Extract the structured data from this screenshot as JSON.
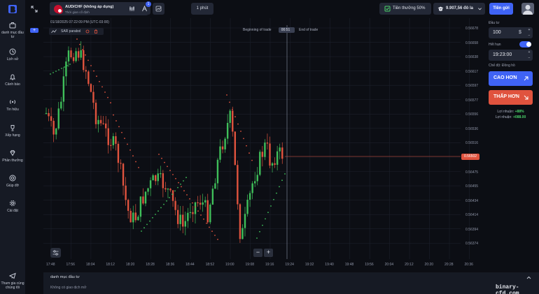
{
  "sidebar": {
    "logo": "brand-logo",
    "badge": "+",
    "items": [
      {
        "label": "danh mục đầu tư",
        "icon": "briefcase-icon"
      },
      {
        "label": "Lịch sử",
        "icon": "history-icon"
      },
      {
        "label": "Cảnh báo",
        "icon": "bell-icon"
      },
      {
        "label": "Tin hiệu",
        "icon": "signal-icon"
      },
      {
        "label": "Xếp hạng",
        "icon": "trophy-icon"
      },
      {
        "label": "Phần thưởng",
        "icon": "diamond-icon"
      },
      {
        "label": "Giúp đỡ",
        "icon": "help-icon"
      },
      {
        "label": "Cài đặt",
        "icon": "gear-icon"
      },
      {
        "label": "Tham gia cùng chúng tôi",
        "icon": "telegram-icon"
      }
    ]
  },
  "header": {
    "asset_name": "AUD/CHF (không áp dụng)",
    "asset_sub": "Thời gian cố định",
    "tool_badge": "1",
    "timeframe": "1 phút",
    "bonus": "Tiền thưởng 50%",
    "balance": "9.907,56 đô la",
    "deposit": "Tiền gửi"
  },
  "chart": {
    "datetime": "01/18/2025 07:22:09 PM (UTC-03:00)",
    "indicator": "SAR parabol",
    "trade_begin": "Beginning of trade",
    "trade_timer": "00:51",
    "trade_end": "End of trade",
    "price_tag": "0.56502",
    "y_labels": [
      "0.56678",
      "0.56658",
      "0.56638",
      "0.56617",
      "0.56597",
      "0.56577",
      "0.56556",
      "0.56536",
      "0.56516",
      "0.56495",
      "0.56475",
      "0.56455",
      "0.56434",
      "0.56414",
      "0.56394",
      "0.56374"
    ],
    "x_labels": [
      "17:48",
      "17:56",
      "18:04",
      "18:12",
      "18:20",
      "18:28",
      "18:36",
      "18:44",
      "18:52",
      "19:00",
      "19:08",
      "19:16",
      "19:24",
      "19:32",
      "19:40",
      "19:48",
      "19:56",
      "20:04",
      "20:12",
      "20:20",
      "20:28",
      "20:36"
    ],
    "zoom_out": "−",
    "zoom_in": "+"
  },
  "chart_data": {
    "type": "candlestick",
    "title": "",
    "xlabel": "",
    "ylabel": "",
    "ylim": [
      0.56364,
      0.56688
    ],
    "colors": {
      "up": "#3fbf5a",
      "down": "#e0533e"
    },
    "current_price": 0.56502
  },
  "panel": {
    "invest_label": "Đầu tư",
    "invest_value": "100",
    "invest_unit": "$",
    "expiry_label": "Hết hạn",
    "expiry_value": "19:23:00",
    "mode": "Chế độ: Đồng hồ",
    "higher": "CAO HƠN",
    "lower": "THẤP HƠN",
    "profit_pct_label": "Lợi nhuận:",
    "profit_pct": "+88%",
    "profit_amt_label": "Lợi nhuận:",
    "profit_amt": "+088.00"
  },
  "bottom": {
    "title": "danh mục đầu tư",
    "subtitle": "Không có giao dịch mở"
  },
  "watermark": "binary-cfd.com"
}
